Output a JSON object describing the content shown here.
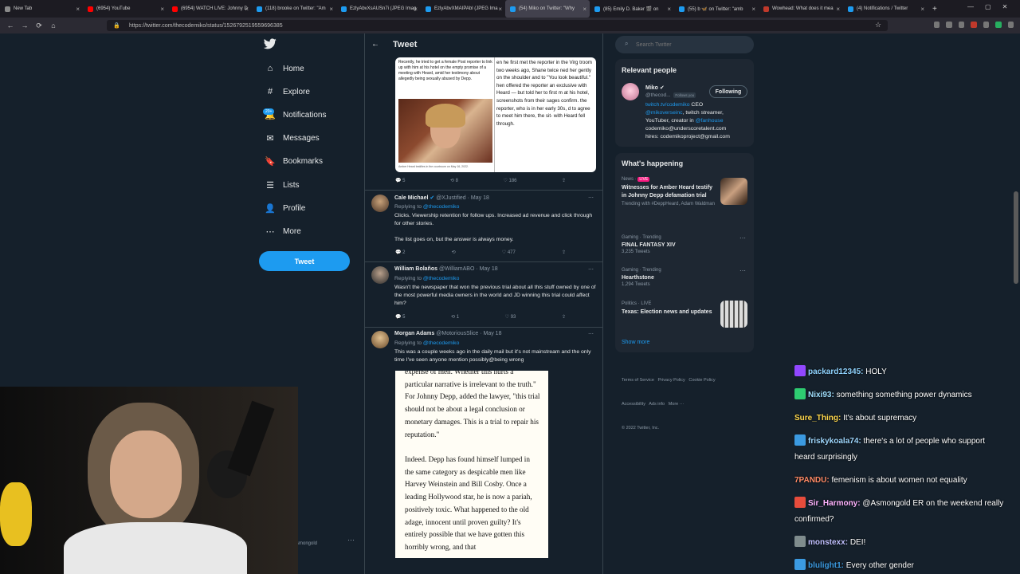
{
  "browser": {
    "tabs": [
      {
        "label": "New Tab",
        "color": "#8a8a8a"
      },
      {
        "label": "(6954) YouTube",
        "color": "#ff0000"
      },
      {
        "label": "(6954) WATCH LIVE: Johnny D",
        "color": "#ff0000"
      },
      {
        "label": "(118) brooke on Twitter: \"Am",
        "color": "#1d9bf0"
      },
      {
        "label": "EzlyAbvXsAUSn7i (JPEG Imag",
        "color": "#1d9bf0"
      },
      {
        "label": "EzlyAbvXMAIPAbl (JPEG Ima",
        "color": "#1d9bf0"
      },
      {
        "label": "(54) Miko on Twitter: \"Why",
        "color": "#1d9bf0"
      },
      {
        "label": "(85) Emily D. Baker 🎬 on",
        "color": "#1d9bf0"
      },
      {
        "label": "(55) b 🦋 on Twitter: \"amb",
        "color": "#1d9bf0"
      },
      {
        "label": "Wowhead: What does it mea",
        "color": "#c0392b"
      },
      {
        "label": "(4) Notifications / Twitter",
        "color": "#1d9bf0"
      }
    ],
    "new_tab": "+",
    "url": "https://twitter.com/thecodemiko/status/1526792519559696385"
  },
  "nav": {
    "items": [
      {
        "label": "Home",
        "icon": "home-icon",
        "glyph": "⌂"
      },
      {
        "label": "Explore",
        "icon": "hashtag-icon",
        "glyph": "#"
      },
      {
        "label": "Notifications",
        "icon": "bell-icon",
        "glyph": "🔔"
      },
      {
        "label": "Messages",
        "icon": "mail-icon",
        "glyph": "✉"
      },
      {
        "label": "Bookmarks",
        "icon": "bookmark-icon",
        "glyph": "🔖"
      },
      {
        "label": "Lists",
        "icon": "list-icon",
        "glyph": "☰"
      },
      {
        "label": "Profile",
        "icon": "person-icon",
        "glyph": "👤"
      },
      {
        "label": "More",
        "icon": "more-icon",
        "glyph": "⋯"
      }
    ],
    "notif_badge": "20+",
    "tweet_button": "Tweet",
    "account_handle": "smongold"
  },
  "column": {
    "title": "Tweet",
    "image_left_text": "Recently, he tried to get a female Post reporter to link up with him at his hotel on the empty promise of a meeting with Heard, amid her testimony about allegedly being sexually abused by Depp.",
    "image_caption": "Amber Heard testifies in the courtroom on May 16, 2022.",
    "image_right_text": "en he first met the reporter in the Virg troom two weeks ago, Shane twice ned her gently on the shoulder and to \"You look beautiful.\" hen offered the reporter an exclusive with Heard — but told her to first m at his hotel, screenshots from their sages confirm. the reporter, who is in her early 30s, d to agree to meet him there, the sit- with Heard fell through.",
    "top_actions": {
      "replies": "5",
      "retweets": "8",
      "likes": "186"
    }
  },
  "replies": [
    {
      "name": "Cale Michael",
      "handle": "@XJustified",
      "date": "May 18",
      "replying_to": "@thecodemiko",
      "text": "Clicks. Viewership retention for follow ups. Increased ad revenue and click through for other stories.",
      "text2": "The list goes on, but the answer is always money.",
      "replies": "2",
      "retweets": "",
      "likes": "477"
    },
    {
      "name": "William Bolaños",
      "handle": "@WilliamABO",
      "date": "May 18",
      "replying_to": "@thecodemiko",
      "text": "Wasn't the newspaper that won the previous trial about all this stuff owned by one of the most powerful media owners in the world and JD winning this trial could affect him?",
      "replies": "5",
      "retweets": "1",
      "likes": "93"
    },
    {
      "name": "Morgan Adams",
      "handle": "@MotoriousSlice",
      "date": "May 18",
      "replying_to": "@thecodemiko",
      "text": "This was a couple weeks ago in the daily mail but it's not mainstream and the only time I've seen anyone mention possibly@being wrong"
    }
  ],
  "replying_prefix": "Replying to",
  "article": {
    "p1": "expense of men. Whether this hurts a particular narrative is irrelevant to the truth.\" For Johnny Depp, added the lawyer, \"this trial should not be about a legal conclusion or monetary damages. This is a trial to repair his reputation.\"",
    "p2": "Indeed. Depp has found himself lumped in the same category as despicable men like Harvey Weinstein and Bill Cosby. Once a leading Hollywood star, he is now a pariah, positively toxic. What happened to the old adage, innocent until proven guilty? It's entirely possible that we have gotten this horribly wrong, and that"
  },
  "sidebar": {
    "search_placeholder": "Search Twitter",
    "relevant_title": "Relevant people",
    "person": {
      "name": "Miko",
      "handle": "@thecod...",
      "follows_you": "Follows you",
      "following_btn": "Following",
      "bio_link": "twitch.tv/codemiko",
      "bio_ceo": " CEO",
      "bio_mention1": "@mikoverseinc",
      "bio_mid": ", twitch streamer, YouTuber, creator in ",
      "bio_mention2": "@fanhouse",
      "bio_email1": "codemiko@underscoretalent.com",
      "bio_email2": "hires: codemikoproject@gmail.com"
    },
    "happening_title": "What's happening",
    "trends": [
      {
        "meta": "News · ",
        "live": "LIVE",
        "title": "Witnesses for Amber Heard testify in Johnny Depp defamation trial",
        "sub": "Trending with #DeppHeard, Adam Waldman"
      },
      {
        "meta": "Gaming · Trending",
        "title": "FINAL FANTASY XIV",
        "sub": "3,235 Tweets"
      },
      {
        "meta": "Gaming · Trending",
        "title": "Hearthstone",
        "sub": "1,294 Tweets"
      },
      {
        "meta": "Politics · LIVE",
        "title": "Texas: Election news and updates",
        "sub": ""
      }
    ],
    "show_more": "Show more",
    "footer1": "Terms of Service   Privacy Policy   Cookie Policy",
    "footer2": "Accessibility   Ads info   More ···",
    "footer3": "© 2022 Twitter, Inc."
  },
  "chat": [
    {
      "user": "packard12345",
      "color": "#8fd3ff",
      "msg": "HOLY",
      "badge": "#9147ff"
    },
    {
      "user": "Nixi93",
      "color": "#a0e0ff",
      "msg": "something something power dynamics",
      "badge": "#2ecc71"
    },
    {
      "user": "Sure_Thing",
      "color": "#ffd84d",
      "msg": "It's about supremacy",
      "badge": ""
    },
    {
      "user": "friskykoala74",
      "color": "#9fd8ff",
      "msg": "there's a lot of people who support",
      "msg2": "heard surprisingly",
      "badge": "#3b9ae1"
    },
    {
      "user": "7PANDU",
      "color": "#ff8a65",
      "msg": "femenism is about women not equality",
      "badge": ""
    },
    {
      "user": "Sir_Harmony",
      "color": "#ffb3ff",
      "msg": "@Asmongold ER on the weekend really",
      "msg2": "confirmed?",
      "badge": "#e74c3c"
    },
    {
      "user": "monstexx",
      "color": "#c0c0ff",
      "msg": "DEI!",
      "badge": "#7f8c8d"
    },
    {
      "user": "blulight1",
      "color": "#3b9ae1",
      "msg": "Every other gender",
      "badge": "#3b9ae1"
    }
  ]
}
